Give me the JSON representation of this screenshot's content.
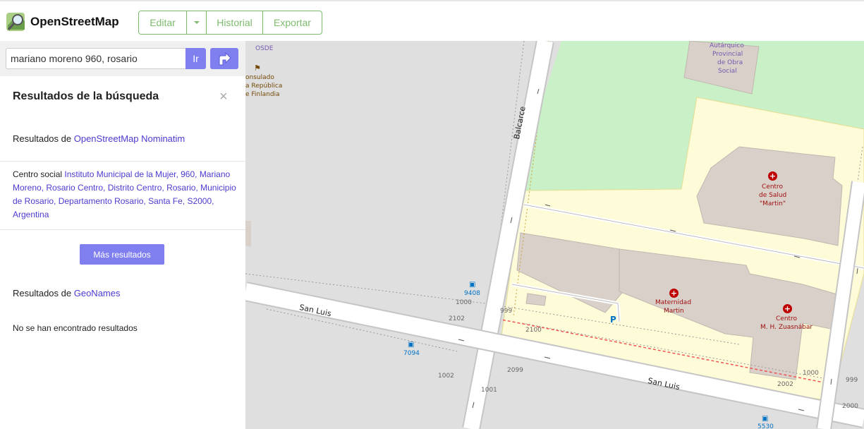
{
  "header": {
    "brand": "OpenStreetMap",
    "edit_label": "Editar",
    "history_label": "Historial",
    "export_label": "Exportar"
  },
  "search": {
    "value": "mariano moreno 960, rosario",
    "go_label": "Ir"
  },
  "results": {
    "title": "Resultados de la búsqueda",
    "close_symbol": "×",
    "source1_prefix": "Resultados de ",
    "source1_link": "OpenStreetMap Nominatim",
    "item1_prefix": "Centro social ",
    "item1_link": "Instituto Municipal de la Mujer, 960, Mariano Moreno, Rosario Centro, Distrito Centro, Rosario, Municipio de Rosario, Departamento Rosario, Santa Fe, S2000, Argentina",
    "more_label": "Más resultados",
    "source2_prefix": "Resultados de ",
    "source2_link": "GeoNames",
    "no_results": "No se han encontrado resultados"
  },
  "map": {
    "streets": {
      "balcarce": "Balcarce",
      "san_luis_1": "San Luis",
      "san_luis_2": "San Luis"
    },
    "pois": {
      "osde": "OSDE",
      "consulado": [
        "onsulado",
        "a República",
        "e Finlandia"
      ],
      "autarquico": [
        "Autárquico",
        "Provincial",
        "de Obra",
        "Social"
      ],
      "centro_salud": [
        "Centro",
        "de Salud",
        "\"Martin\""
      ],
      "maternidad": [
        "Maternidad",
        "Martin"
      ],
      "zuasnabar": [
        "Centro",
        "M. H. Zuasnábar"
      ],
      "parking": "P"
    },
    "bus_stops": [
      "9408",
      "7094",
      "5530"
    ],
    "house_numbers": [
      "1000",
      "2102",
      "999",
      "2100",
      "2099",
      "1002",
      "1001",
      "1000",
      "2002",
      "999",
      "2000"
    ]
  }
}
